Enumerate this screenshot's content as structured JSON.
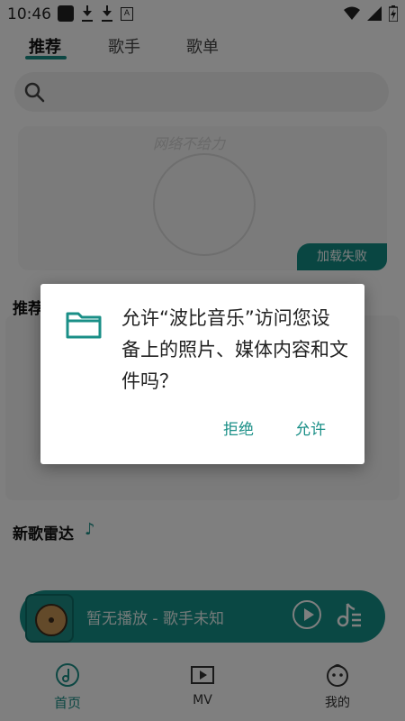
{
  "status_bar": {
    "time": "10:46"
  },
  "tabs": [
    {
      "label": "推荐"
    },
    {
      "label": "歌手"
    },
    {
      "label": "歌单"
    }
  ],
  "banner": {
    "ghost_text": "网络不给力",
    "fail_label": "加载失败"
  },
  "sections": {
    "recommend_title": "推荐",
    "new_songs_title": "新歌雷达"
  },
  "player": {
    "now_playing": "暂无播放 - 歌手未知"
  },
  "bottom_nav": [
    {
      "label": "首页"
    },
    {
      "label": "MV"
    },
    {
      "label": "我的"
    }
  ],
  "dialog": {
    "message": "允许“波比音乐”访问您设备上的照片、媒体内容和文件吗？",
    "deny_label": "拒绝",
    "allow_label": "允许"
  },
  "colors": {
    "accent": "#1a8f87",
    "scrim": "rgba(0,0,0,0.5)"
  }
}
